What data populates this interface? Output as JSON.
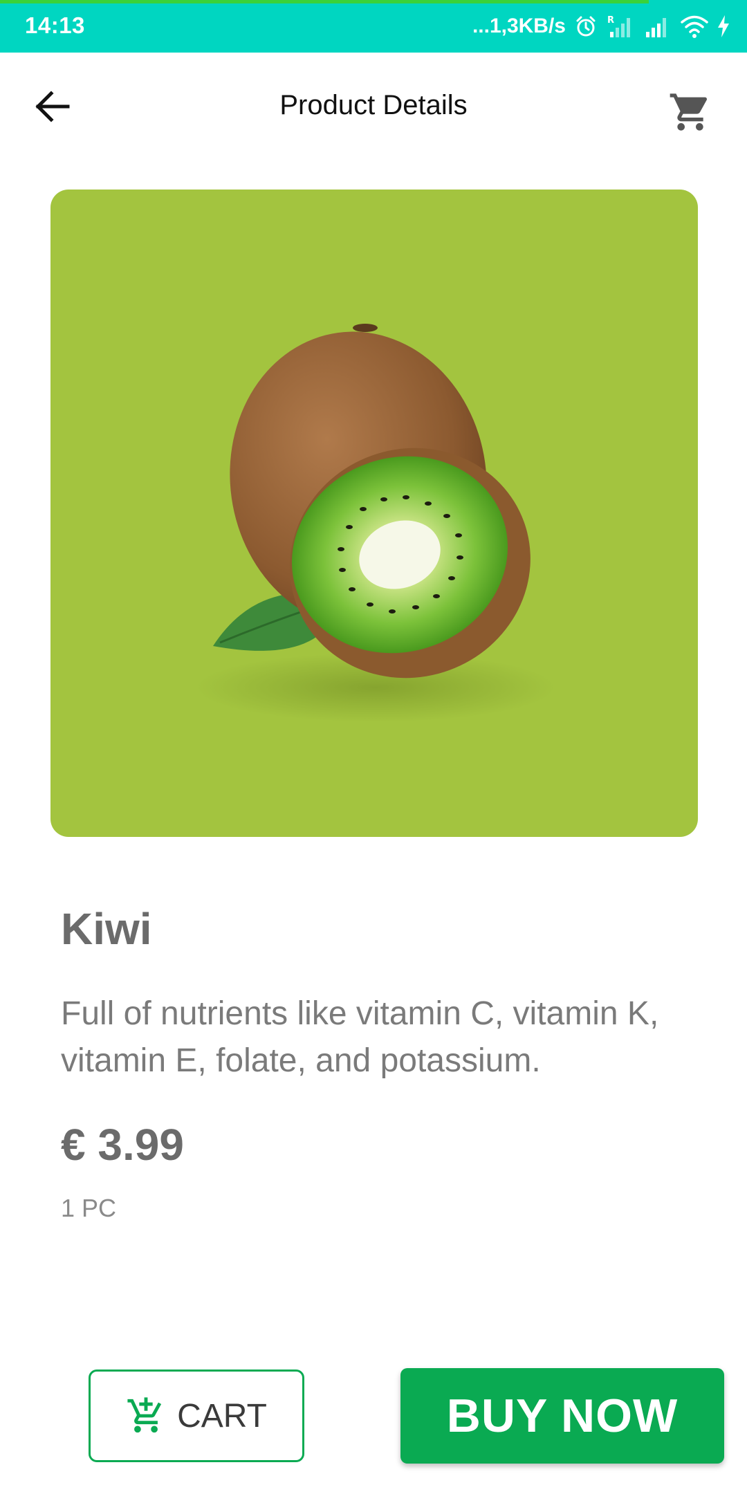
{
  "status_bar": {
    "time": "14:13",
    "network_speed": "...1,3KB/s",
    "icons": [
      "alarm-icon",
      "signal-roaming-icon",
      "signal-icon",
      "wifi-icon",
      "charging-icon"
    ],
    "background_color": "#00d6c1"
  },
  "header": {
    "title": "Product Details",
    "back_icon": "arrow-left-icon",
    "cart_icon": "shopping-cart-icon"
  },
  "product": {
    "image_icon": "kiwi-image",
    "image_background": "#a3c43f",
    "name": "Kiwi",
    "description": "Full of nutrients like vitamin C, vitamin K, vitamin E, folate, and potassium.",
    "price": "€ 3.99",
    "unit": "1 PC"
  },
  "actions": {
    "add_to_cart_label": "CART",
    "add_to_cart_icon": "cart-plus-icon",
    "buy_now_label": "BUY NOW",
    "accent_color": "#0aaa52"
  }
}
